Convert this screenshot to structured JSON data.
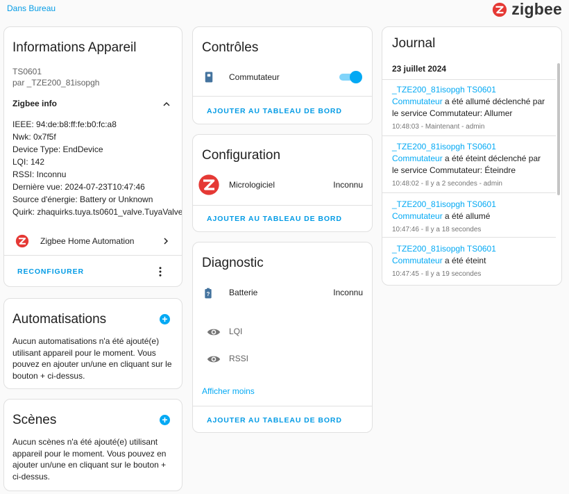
{
  "header": {
    "area_link": "Dans Bureau",
    "brand_text": "zigbee"
  },
  "device_info": {
    "title": "Informations Appareil",
    "model": "TS0601",
    "manufacturer": "par _TZE200_81isopgh",
    "zigbee_info_label": "Zigbee info",
    "ieee": "IEEE: 94:de:b8:ff:fe:b0:fc:a8",
    "nwk": "Nwk: 0x7f5f",
    "device_type": "Device Type: EndDevice",
    "lqi": "LQI: 142",
    "rssi": "RSSI: Inconnu",
    "last_seen": "Dernière vue: 2024-07-23T10:47:46",
    "power_source": "Source d'énergie: Battery or Unknown",
    "quirk": "Quirk: zhaquirks.tuya.ts0601_valve.TuyaValve",
    "integration": "Zigbee Home Automation",
    "reconfigure": "RECONFIGURER"
  },
  "automations": {
    "title": "Automatisations",
    "text": "Aucun automatisations n'a été ajouté(e) utilisant appareil pour le moment. Vous pouvez en ajouter un/une en cliquant sur le bouton + ci-dessus."
  },
  "scenes": {
    "title": "Scènes",
    "text": "Aucun scènes n'a été ajouté(e) utilisant appareil pour le moment. Vous pouvez en ajouter un/une en cliquant sur le bouton + ci-dessus."
  },
  "controls": {
    "title": "Contrôles",
    "switch_label": "Commutateur",
    "switch_on": true,
    "add_to_dashboard": "AJOUTER AU TABLEAU DE BORD"
  },
  "configuration": {
    "title": "Configuration",
    "firmware_label": "Micrologiciel",
    "firmware_value": "Inconnu",
    "add_to_dashboard": "AJOUTER AU TABLEAU DE BORD"
  },
  "diagnostic": {
    "title": "Diagnostic",
    "battery_label": "Batterie",
    "battery_value": "Inconnu",
    "lqi_label": "LQI",
    "rssi_label": "RSSI",
    "show_less": "Afficher moins",
    "add_to_dashboard": "AJOUTER AU TABLEAU DE BORD"
  },
  "journal": {
    "title": "Journal",
    "date": "23 juillet 2024",
    "entries": [
      {
        "entity": "_TZE200_81isopgh TS0601 Commutateur",
        "text": " a été allumé déclenché par le service Commutateur: Allumer",
        "meta": "10:48:03 - Maintenant - admin"
      },
      {
        "entity": "_TZE200_81isopgh TS0601 Commutateur",
        "text": " a été éteint déclenché par le service Commutateur: Éteindre",
        "meta": "10:48:02 - Il y a 2 secondes - admin"
      },
      {
        "entity": "_TZE200_81isopgh TS0601 Commutateur",
        "text": " a été allumé",
        "meta": "10:47:46 - Il y a 18 secondes"
      },
      {
        "entity": "_TZE200_81isopgh TS0601 Commutateur",
        "text": " a été éteint",
        "meta": "10:47:45 - Il y a 19 secondes"
      }
    ]
  },
  "colors": {
    "accent": "#03a9f4",
    "link": "#039be5",
    "brand_red": "#e53935"
  }
}
